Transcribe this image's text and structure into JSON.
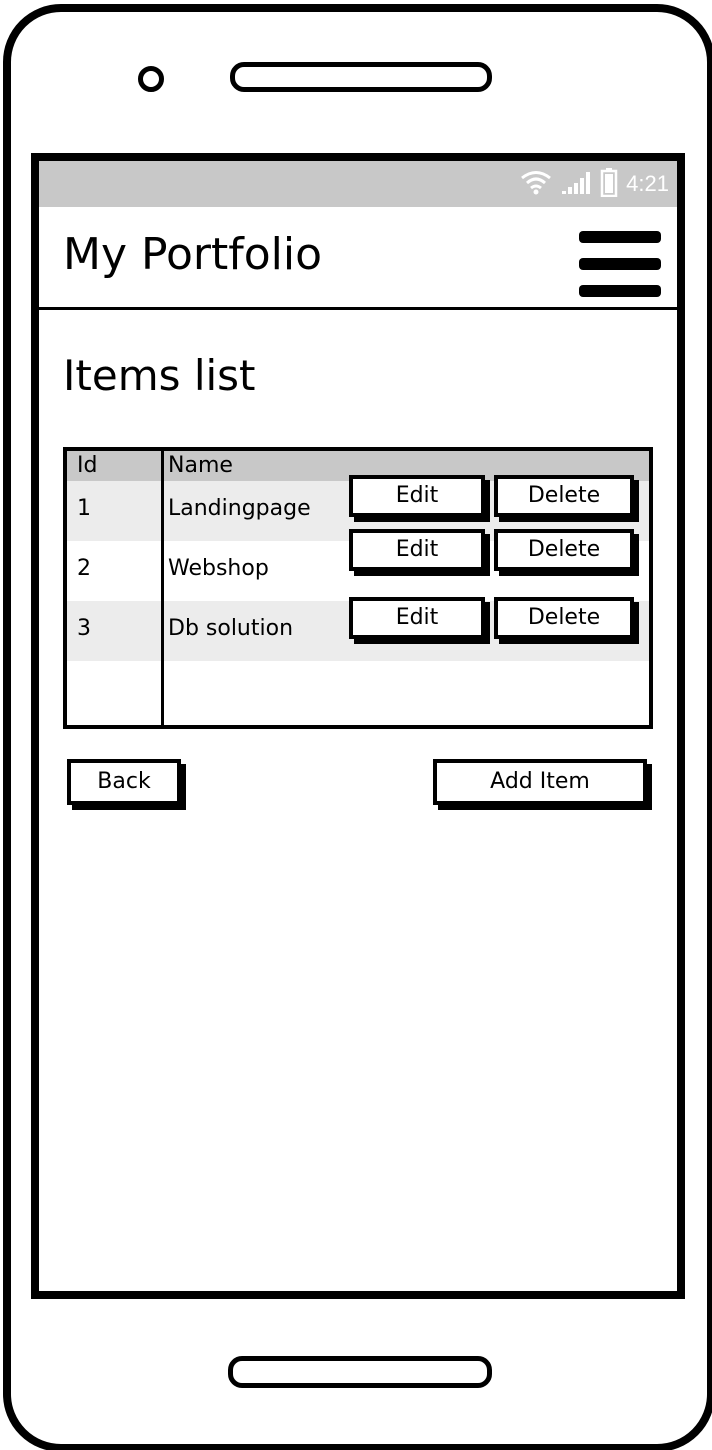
{
  "status_bar": {
    "time": "4:21",
    "icons": [
      "wifi-icon",
      "signal-icon",
      "battery-icon"
    ]
  },
  "app_bar": {
    "title": "My Portfolio",
    "menu_icon": "hamburger-menu-icon"
  },
  "page": {
    "heading": "Items list"
  },
  "table": {
    "columns": [
      "Id",
      "Name"
    ],
    "rows": [
      {
        "id": "1",
        "name": "Landingpage",
        "edit_label": "Edit",
        "delete_label": "Delete"
      },
      {
        "id": "2",
        "name": "Webshop",
        "edit_label": "Edit",
        "delete_label": "Delete"
      },
      {
        "id": "3",
        "name": "Db solution",
        "edit_label": "Edit",
        "delete_label": "Delete"
      }
    ]
  },
  "actions": {
    "back_label": "Back",
    "add_item_label": "Add Item"
  },
  "colors": {
    "status_bar_bg": "#c8c8c8",
    "header_row_bg": "#c8c8c8",
    "shaded_row_bg": "#ececec",
    "ink": "#000000"
  }
}
